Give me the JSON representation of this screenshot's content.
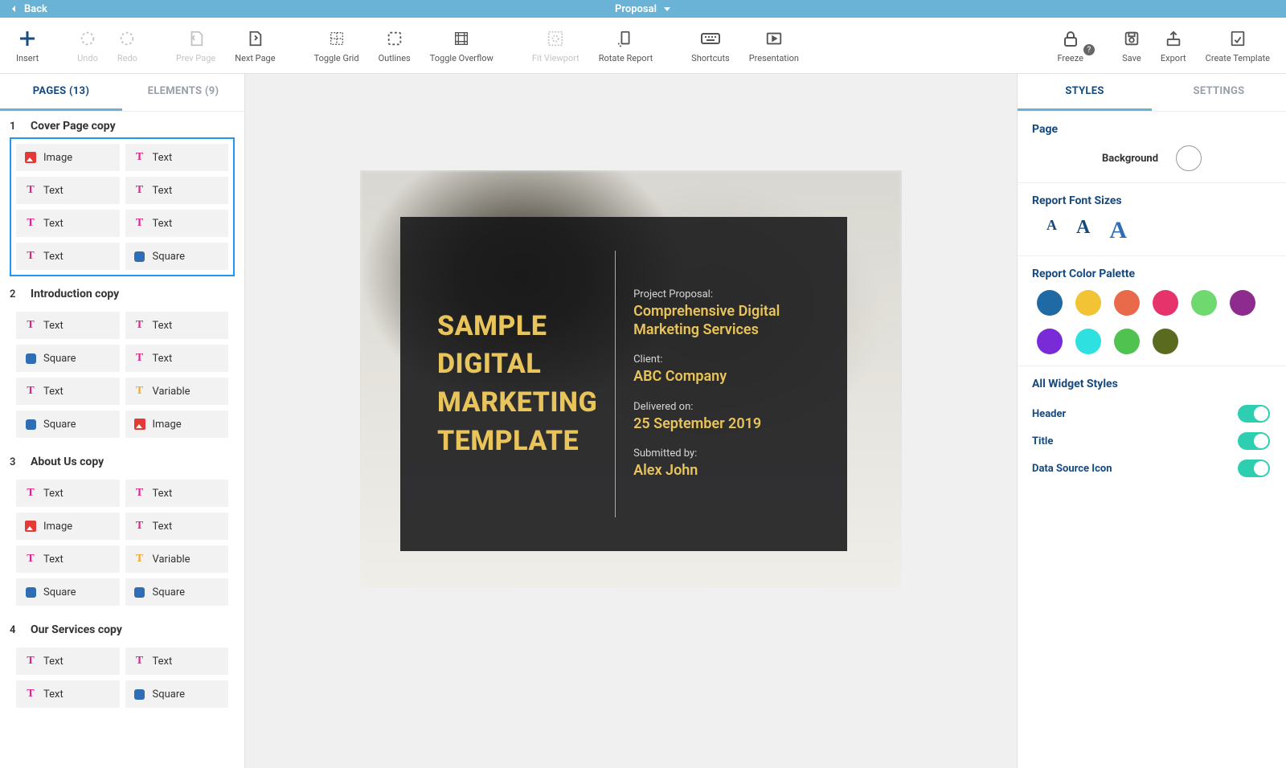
{
  "topbar": {
    "back": "Back",
    "title": "Proposal"
  },
  "toolbar": {
    "insert": "Insert",
    "undo": "Undo",
    "redo": "Redo",
    "prevPage": "Prev Page",
    "nextPage": "Next Page",
    "toggleGrid": "Toggle Grid",
    "outlines": "Outlines",
    "toggleOverflow": "Toggle Overflow",
    "fitViewport": "Fit Viewport",
    "rotateReport": "Rotate Report",
    "shortcuts": "Shortcuts",
    "presentation": "Presentation",
    "freeze": "Freeze",
    "save": "Save",
    "export": "Export",
    "createTemplate": "Create Template"
  },
  "leftTabs": {
    "pages": "PAGES (13)",
    "elements": "ELEMENTS (9)"
  },
  "pages": [
    {
      "num": "1",
      "title": "Cover Page copy",
      "selected": true,
      "items": [
        {
          "type": "image",
          "label": "Image"
        },
        {
          "type": "text",
          "label": "Text"
        },
        {
          "type": "text",
          "label": "Text"
        },
        {
          "type": "text",
          "label": "Text"
        },
        {
          "type": "text",
          "label": "Text"
        },
        {
          "type": "text",
          "label": "Text"
        },
        {
          "type": "text",
          "label": "Text"
        },
        {
          "type": "square",
          "label": "Square"
        }
      ]
    },
    {
      "num": "2",
      "title": "Introduction copy",
      "selected": false,
      "items": [
        {
          "type": "text",
          "label": "Text"
        },
        {
          "type": "text",
          "label": "Text"
        },
        {
          "type": "square",
          "label": "Square"
        },
        {
          "type": "text",
          "label": "Text"
        },
        {
          "type": "text",
          "label": "Text"
        },
        {
          "type": "variable",
          "label": "Variable"
        },
        {
          "type": "square",
          "label": "Square"
        },
        {
          "type": "image",
          "label": "Image"
        }
      ]
    },
    {
      "num": "3",
      "title": "About Us copy",
      "selected": false,
      "items": [
        {
          "type": "text",
          "label": "Text"
        },
        {
          "type": "text",
          "label": "Text"
        },
        {
          "type": "image",
          "label": "Image"
        },
        {
          "type": "text",
          "label": "Text"
        },
        {
          "type": "text",
          "label": "Text"
        },
        {
          "type": "variable",
          "label": "Variable"
        },
        {
          "type": "square",
          "label": "Square"
        },
        {
          "type": "square",
          "label": "Square"
        }
      ]
    },
    {
      "num": "4",
      "title": "Our Services copy",
      "selected": false,
      "items": [
        {
          "type": "text",
          "label": "Text"
        },
        {
          "type": "text",
          "label": "Text"
        },
        {
          "type": "text",
          "label": "Text"
        },
        {
          "type": "square",
          "label": "Square"
        }
      ]
    }
  ],
  "cover": {
    "title1": "SAMPLE",
    "title2": "DIGITAL",
    "title3": "MARKETING",
    "title4": "TEMPLATE",
    "meta": [
      {
        "label": "Project Proposal:",
        "value": "Comprehensive Digital Marketing Services"
      },
      {
        "label": "Client:",
        "value": "ABC Company"
      },
      {
        "label": "Delivered on:",
        "value": "25 September 2019"
      },
      {
        "label": "Submitted by:",
        "value": "Alex John"
      }
    ]
  },
  "rightTabs": {
    "styles": "STYLES",
    "settings": "SETTINGS"
  },
  "styles": {
    "pageTitle": "Page",
    "background": "Background",
    "fontSizesTitle": "Report Font Sizes",
    "fontGlyph": "A",
    "paletteTitle": "Report Color Palette",
    "palette": [
      "#1f6aa5",
      "#f2c335",
      "#e86a4a",
      "#e6336b",
      "#6fd86f",
      "#8e2b8e",
      "#7a2bd8",
      "#2fe0e0",
      "#4fc24f",
      "#5a6b1f"
    ],
    "widgetTitle": "All Widget Styles",
    "toggles": [
      {
        "label": "Header"
      },
      {
        "label": "Title"
      },
      {
        "label": "Data Source Icon"
      }
    ]
  }
}
